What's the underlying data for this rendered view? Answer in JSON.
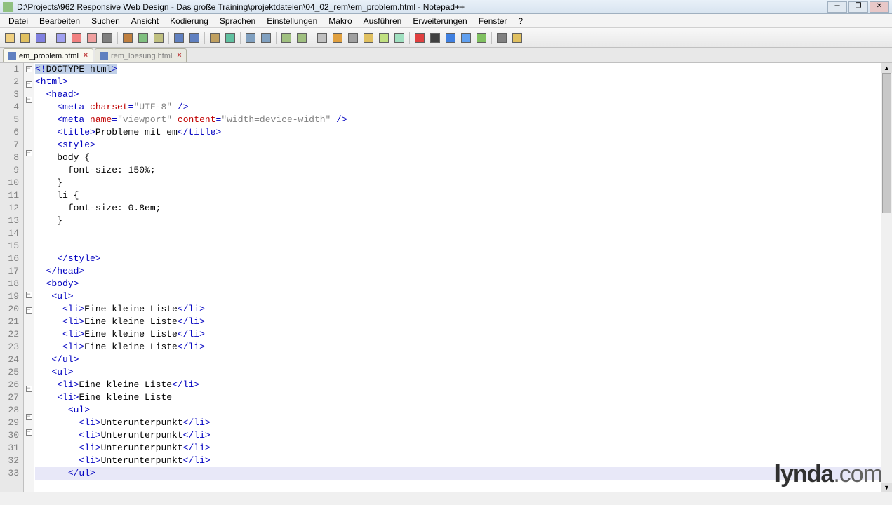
{
  "window": {
    "title": "D:\\Projects\\962 Responsive Web Design - Das große Training\\projektdateien\\04_02_rem\\em_problem.html - Notepad++"
  },
  "menu": [
    "Datei",
    "Bearbeiten",
    "Suchen",
    "Ansicht",
    "Kodierung",
    "Sprachen",
    "Einstellungen",
    "Makro",
    "Ausführen",
    "Erweiterungen",
    "Fenster",
    "?"
  ],
  "tabs": [
    {
      "name": "em_problem.html",
      "active": true
    },
    {
      "name": "rem_loesung.html",
      "active": false
    }
  ],
  "lines": [
    {
      "n": 1,
      "fold": "box",
      "html": "<span class='sel'><span class='tag'>&lt;!</span><span class='txt'>DOCTYPE html</span><span class='tag'>&gt;</span></span>"
    },
    {
      "n": 2,
      "fold": "box",
      "html": "<span class='tag'>&lt;html&gt;</span>"
    },
    {
      "n": 3,
      "fold": "box",
      "html": "  <span class='tag'>&lt;head&gt;</span>"
    },
    {
      "n": 4,
      "fold": "line",
      "html": "    <span class='tag'>&lt;meta</span> <span class='attr'>charset</span><span class='tag'>=</span><span class='str'>\"UTF-8\"</span> <span class='tag'>/&gt;</span>"
    },
    {
      "n": 5,
      "fold": "line",
      "html": "    <span class='tag'>&lt;meta</span> <span class='attr'>name</span><span class='tag'>=</span><span class='str'>\"viewport\"</span> <span class='attr'>content</span><span class='tag'>=</span><span class='str'>\"width=device-width\"</span> <span class='tag'>/&gt;</span>"
    },
    {
      "n": 6,
      "fold": "line",
      "html": "    <span class='tag'>&lt;title&gt;</span><span class='txt'>Probleme mit em</span><span class='tag'>&lt;/title&gt;</span>"
    },
    {
      "n": 7,
      "fold": "box",
      "html": "    <span class='tag'>&lt;style&gt;</span>"
    },
    {
      "n": 8,
      "fold": "line",
      "html": "    <span class='txt'>body {</span>"
    },
    {
      "n": 9,
      "fold": "line",
      "html": "      <span class='txt'>font-size: 150%;</span>"
    },
    {
      "n": 10,
      "fold": "line",
      "html": "    <span class='txt'>}</span>"
    },
    {
      "n": 11,
      "fold": "line",
      "html": "    <span class='txt'>li {</span>"
    },
    {
      "n": 12,
      "fold": "line",
      "html": "      <span class='txt'>font-size: 0.8em;</span>"
    },
    {
      "n": 13,
      "fold": "line",
      "html": "    <span class='txt'>}</span>"
    },
    {
      "n": 14,
      "fold": "line",
      "html": ""
    },
    {
      "n": 15,
      "fold": "line",
      "html": "    "
    },
    {
      "n": 16,
      "fold": "line",
      "html": "    <span class='tag'>&lt;/style&gt;</span>"
    },
    {
      "n": 17,
      "fold": "line",
      "html": "  <span class='tag'>&lt;/head&gt;</span>"
    },
    {
      "n": 18,
      "fold": "box",
      "html": "  <span class='tag'>&lt;body&gt;</span>"
    },
    {
      "n": 19,
      "fold": "box",
      "html": "   <span class='tag'>&lt;ul&gt;</span>"
    },
    {
      "n": 20,
      "fold": "line",
      "html": "     <span class='tag'>&lt;li&gt;</span><span class='txt'>Eine kleine Liste</span><span class='tag'>&lt;/li&gt;</span>"
    },
    {
      "n": 21,
      "fold": "line",
      "html": "     <span class='tag'>&lt;li&gt;</span><span class='txt'>Eine kleine Liste</span><span class='tag'>&lt;/li&gt;</span>"
    },
    {
      "n": 22,
      "fold": "line",
      "html": "     <span class='tag'>&lt;li&gt;</span><span class='txt'>Eine kleine Liste</span><span class='tag'>&lt;/li&gt;</span>"
    },
    {
      "n": 23,
      "fold": "line",
      "html": "     <span class='tag'>&lt;li&gt;</span><span class='txt'>Eine kleine Liste</span><span class='tag'>&lt;/li&gt;</span>"
    },
    {
      "n": 24,
      "fold": "line",
      "html": "   <span class='tag'>&lt;/ul&gt;</span>"
    },
    {
      "n": 25,
      "fold": "box",
      "html": "   <span class='tag'>&lt;ul&gt;</span>"
    },
    {
      "n": 26,
      "fold": "line",
      "html": "    <span class='tag'>&lt;li&gt;</span><span class='txt'>Eine kleine Liste</span><span class='tag'>&lt;/li&gt;</span>"
    },
    {
      "n": 27,
      "fold": "box",
      "html": "    <span class='tag'>&lt;li&gt;</span><span class='txt'>Eine kleine Liste</span>"
    },
    {
      "n": 28,
      "fold": "box",
      "html": "      <span class='tag'>&lt;ul&gt;</span>"
    },
    {
      "n": 29,
      "fold": "line",
      "html": "        <span class='tag'>&lt;li&gt;</span><span class='txt'>Unterunterpunkt</span><span class='tag'>&lt;/li&gt;</span>"
    },
    {
      "n": 30,
      "fold": "line",
      "html": "        <span class='tag'>&lt;li&gt;</span><span class='txt'>Unterunterpunkt</span><span class='tag'>&lt;/li&gt;</span>"
    },
    {
      "n": 31,
      "fold": "line",
      "html": "        <span class='tag'>&lt;li&gt;</span><span class='txt'>Unterunterpunkt</span><span class='tag'>&lt;/li&gt;</span>"
    },
    {
      "n": 32,
      "fold": "line",
      "html": "        <span class='tag'>&lt;li&gt;</span><span class='txt'>Unterunterpunkt</span><span class='tag'>&lt;/li&gt;</span>"
    },
    {
      "n": 33,
      "fold": "line",
      "current": true,
      "html": "      <span class='tag'>&lt;/ul&gt;</span>"
    }
  ],
  "watermark": {
    "bold": "lynda",
    "rest": ".com"
  },
  "toolbar_icons": [
    "new-file-icon",
    "open-icon",
    "save-icon",
    "save-all-icon",
    "close-icon",
    "close-all-icon",
    "print-icon",
    "cut-icon",
    "copy-icon",
    "paste-icon",
    "undo-icon",
    "redo-icon",
    "find-icon",
    "replace-icon",
    "zoom-in-icon",
    "zoom-out-icon",
    "sync-v-icon",
    "sync-h-icon",
    "wordwrap-icon",
    "show-all-icon",
    "indent-guide-icon",
    "folder-icon",
    "doc-map-icon",
    "function-list-icon",
    "record-icon",
    "stop-icon",
    "play-icon",
    "play-multi-icon",
    "save-macro-icon",
    "spell-icon",
    "doc-switch-icon"
  ]
}
